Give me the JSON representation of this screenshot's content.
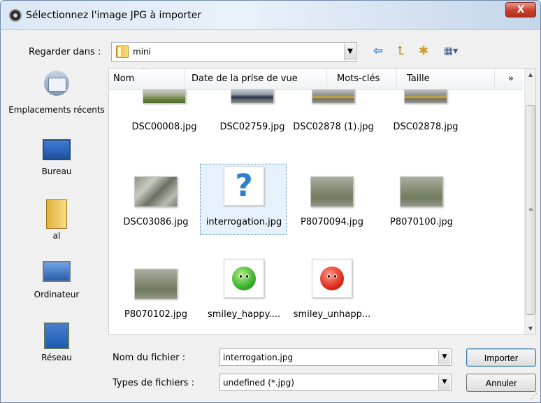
{
  "window": {
    "title": "Sélectionnez l'image JPG à importer",
    "close_label": "X"
  },
  "lookin": {
    "label": "Regarder dans :",
    "value": "mini"
  },
  "toolbar_icons": [
    "back-arrow-icon",
    "folder-up-icon",
    "new-folder-icon",
    "views-menu-icon"
  ],
  "places": [
    {
      "label": "Emplacements récents",
      "icon": "recent-places-icon"
    },
    {
      "label": "Bureau",
      "icon": "desktop-icon"
    },
    {
      "label": "al",
      "icon": "user-folder-icon"
    },
    {
      "label": "Ordinateur",
      "icon": "computer-icon"
    },
    {
      "label": "Réseau",
      "icon": "network-icon"
    }
  ],
  "columns": {
    "name": "Nom",
    "date": "Date de la prise de vue",
    "tags": "Mots-clés",
    "size": "Taille",
    "more": "»"
  },
  "files": [
    {
      "name": "DSC00008.jpg",
      "thumb": "grass"
    },
    {
      "name": "DSC02759.jpg",
      "thumb": "truck"
    },
    {
      "name": "DSC02878 (1).jpg",
      "thumb": "plane"
    },
    {
      "name": "DSC02878.jpg",
      "thumb": "plane"
    },
    {
      "name": "DSC03086.jpg",
      "thumb": "rock"
    },
    {
      "name": "interrogation.jpg",
      "thumb": "question",
      "selected": true
    },
    {
      "name": "P8070094.jpg",
      "thumb": "field"
    },
    {
      "name": "P8070100.jpg",
      "thumb": "field"
    },
    {
      "name": "P8070102.jpg",
      "thumb": "field"
    },
    {
      "name": "smiley_happy....",
      "thumb": "smiley-green"
    },
    {
      "name": "smiley_unhapp...",
      "thumb": "smiley-red"
    }
  ],
  "filename": {
    "label": "Nom du fichier :",
    "value": "interrogation.jpg"
  },
  "filetype": {
    "label": "Types de fichiers :",
    "value": "undefined (*.jpg)"
  },
  "buttons": {
    "import": "Importer",
    "cancel": "Annuler"
  },
  "colors": {
    "accent": "#2f7fcf",
    "selection": "#e6f1fb"
  }
}
